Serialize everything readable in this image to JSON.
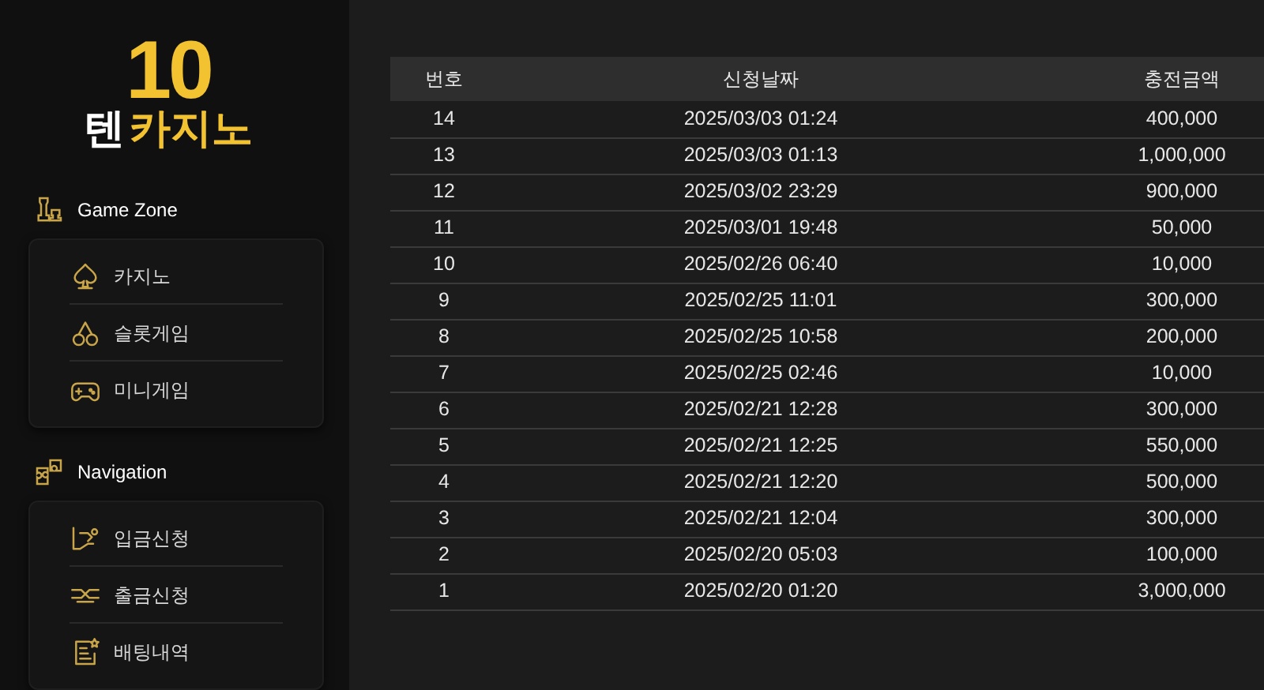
{
  "logo": {
    "number": "10",
    "word_white": "텐",
    "word_gold": "카지노"
  },
  "sidebar": {
    "sections": [
      {
        "title": "Game Zone",
        "kind": "games",
        "items": [
          {
            "label": "카지노",
            "kind": "spade"
          },
          {
            "label": "슬롯게임",
            "kind": "cherry"
          },
          {
            "label": "미니게임",
            "kind": "gamepad"
          }
        ]
      },
      {
        "title": "Navigation",
        "kind": "nav",
        "items": [
          {
            "label": "입금신청",
            "kind": "deposit"
          },
          {
            "label": "출금신청",
            "kind": "withdraw"
          },
          {
            "label": "배팅내역",
            "kind": "history"
          }
        ]
      }
    ]
  },
  "table": {
    "columns": [
      "번호",
      "신청날짜",
      "충전금액"
    ],
    "rows": [
      [
        "14",
        "2025/03/03 01:24",
        "400,000"
      ],
      [
        "13",
        "2025/03/03 01:13",
        "1,000,000"
      ],
      [
        "12",
        "2025/03/02 23:29",
        "900,000"
      ],
      [
        "11",
        "2025/03/01 19:48",
        "50,000"
      ],
      [
        "10",
        "2025/02/26 06:40",
        "10,000"
      ],
      [
        "9",
        "2025/02/25 11:01",
        "300,000"
      ],
      [
        "8",
        "2025/02/25 10:58",
        "200,000"
      ],
      [
        "7",
        "2025/02/25 02:46",
        "10,000"
      ],
      [
        "6",
        "2025/02/21 12:28",
        "300,000"
      ],
      [
        "5",
        "2025/02/21 12:25",
        "550,000"
      ],
      [
        "4",
        "2025/02/21 12:20",
        "500,000"
      ],
      [
        "3",
        "2025/02/21 12:04",
        "300,000"
      ],
      [
        "2",
        "2025/02/20 05:03",
        "100,000"
      ],
      [
        "1",
        "2025/02/20 01:20",
        "3,000,000"
      ]
    ]
  }
}
